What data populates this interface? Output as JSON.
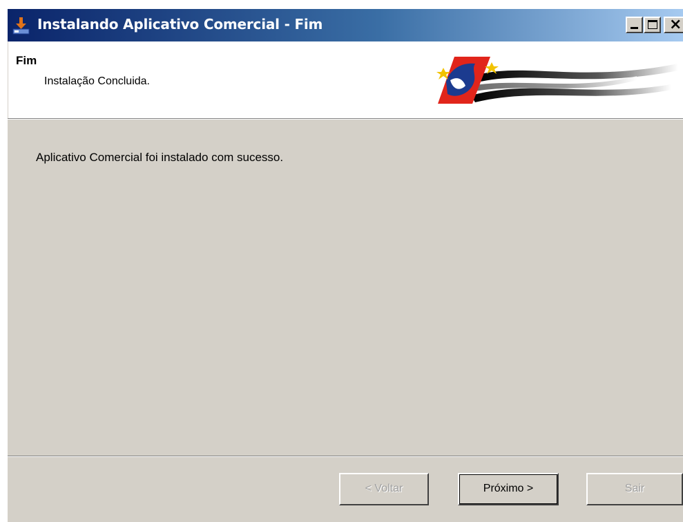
{
  "window": {
    "title": "Instalando Aplicativo Comercial  - Fim",
    "icon": "installer-icon"
  },
  "header": {
    "title": "Fim",
    "subtitle": "Instalação Concluida.",
    "banner": "sao-paulo-flag-banner"
  },
  "body": {
    "message": "Aplicativo Comercial foi instalado com sucesso."
  },
  "buttons": {
    "back": "< Voltar",
    "next": "Próximo >",
    "exit": "Sair"
  },
  "colors": {
    "titlebar_start": "#0a246a",
    "titlebar_end": "#a6caf0",
    "panel": "#d4d0c8",
    "flag_red": "#e1251b",
    "flag_blue": "#1c3b8f"
  }
}
